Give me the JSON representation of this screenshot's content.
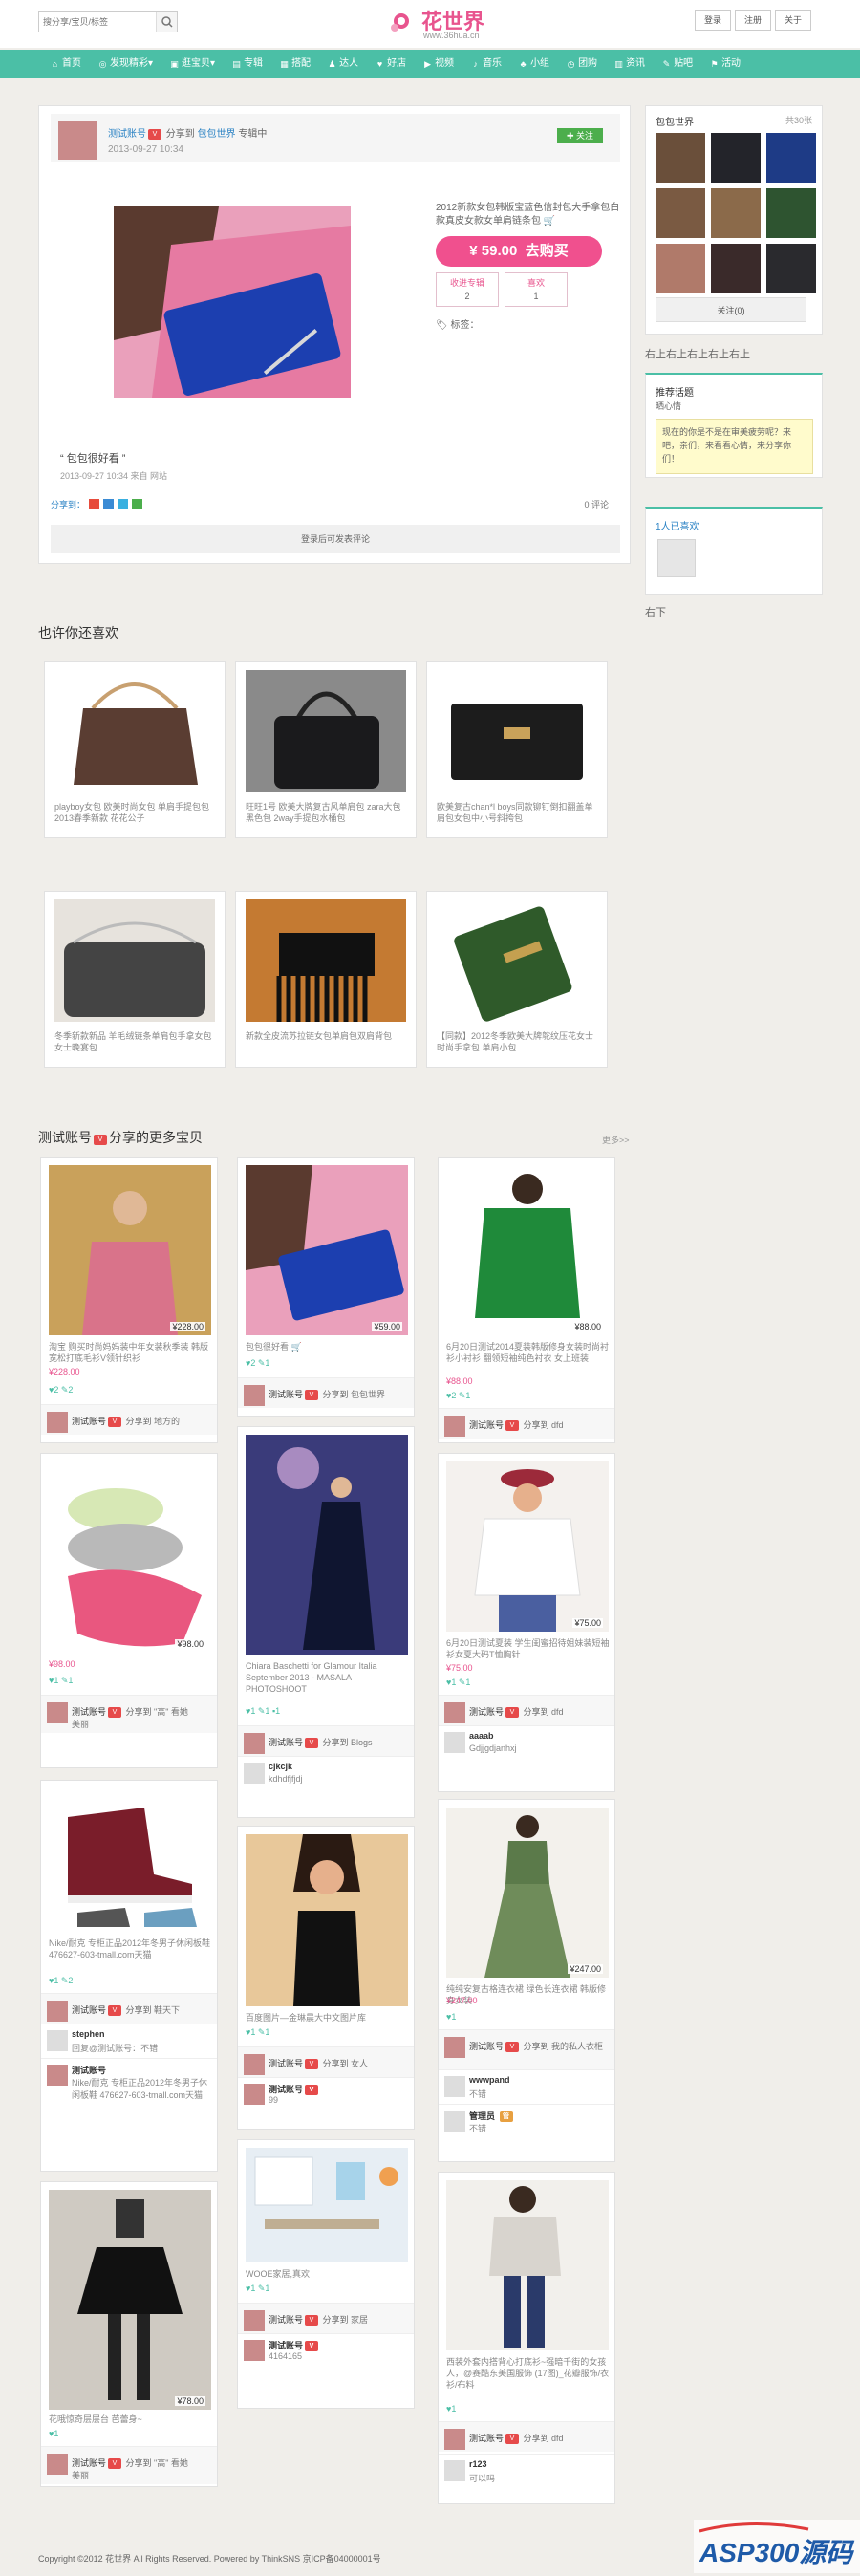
{
  "header": {
    "search_placeholder": "搜分享/宝贝/标签",
    "logo_text": "花世界",
    "logo_url": "www.36hua.cn",
    "links": [
      "登录",
      "注册",
      "关于"
    ]
  },
  "nav": [
    "首页",
    "发现精彩",
    "逛宝贝",
    "专辑",
    "搭配",
    "达人",
    "好店",
    "视频",
    "音乐",
    "小组",
    "团购",
    "资讯",
    "贴吧",
    "活动"
  ],
  "post": {
    "user": "测试账号",
    "verb": "分享到",
    "album": "包包世界",
    "album_suffix": "专辑中",
    "date": "2013-09-27 10:34",
    "follow": "关注",
    "desc": "2012新款女包韩版宝蓝色信封包大手拿包白款真皮女款女单肩链条包",
    "price": "¥ 59.00",
    "buy": "去购买",
    "collect_label": "收进专辑",
    "collect_count": "2",
    "like_label": "喜欢",
    "like_count": "1",
    "tags_label": "标签：",
    "quote": "包包很好看",
    "meta": "2013-09-27 10:34  来自 网站",
    "share_label": "分享到：",
    "comments": "0 评论",
    "login_comment": "登录后可发表评论"
  },
  "sidebar": {
    "title": "包包世界",
    "count": "共30张",
    "follow": "关注(0)",
    "placeholder_text": "右上右上右上右上右上",
    "topic_title": "推荐话题",
    "topic_user": "晒心情",
    "topic_note": "现在的你是不是在审美疲劳呢？来吧，亲们，来看看心情，来分享你们！",
    "likers_title": "1人已喜欢",
    "bottom_text": "右下"
  },
  "related": {
    "title": "也许你还喜欢",
    "items": [
      "playboy女包 欧美时尚女包 单肩手提包包 2013春季新款 花花公子",
      "旺旺1号 欧美大牌复古风单肩包 zara大包黑色包 2way手提包水桶包",
      "欧美复古chan*l boys同款铆钉倒扣翻盖单肩包女包中小号斜挎包",
      "冬季新款新品 羊毛绒链条单肩包手拿女包 女士晚宴包",
      "新款全皮流苏拉链女包单肩包双肩背包",
      "【同款】2012冬季欧美大牌鸵纹压花女士时尚手拿包 单肩小包"
    ]
  },
  "more_section": {
    "title": "测试账号",
    "title_suffix": "分享的更多宝贝",
    "more": "更多>>"
  },
  "waterfall": {
    "c1": [
      {
        "price": "¥228.00",
        "desc": "淘宝 购买时尚妈妈装中年女装秋季装 韩版宽松打底毛衫V领针织衫",
        "line2": "¥228.00",
        "likes": "2",
        "comments": "2",
        "user": "测试账号",
        "album": "地方的"
      },
      {
        "price": "¥98.00",
        "desc": "¥98.00",
        "line2": "",
        "likes": "1",
        "comments": "1",
        "user": "测试账号",
        "album": "\"高\" 看她",
        "album2": "美丽"
      },
      {
        "price": "",
        "desc": "Nike/耐克 专柜正品2012年冬男子休闲板鞋 476627-603-tmall.com天猫",
        "line2": "",
        "likes": "1",
        "comments": "2",
        "user": "测试账号",
        "album": "鞋天下",
        "c_name": "stephen",
        "c_text": "回复@测试账号：不错",
        "c2_name": "测试账号",
        "c2_text": "Nike/耐克 专柜正品2012年冬男子休闲板鞋 476627-603-tmall.com天猫"
      },
      {
        "price": "¥78.00",
        "desc": "花哦惊奇层层台 芭蕾身~",
        "line2": "",
        "likes": "1",
        "comments": "",
        "user": "测试账号",
        "album": "\"高\" 看她",
        "album2": "美丽"
      }
    ],
    "c2": [
      {
        "price": "¥59.00",
        "desc": "包包很好看",
        "line2": "",
        "likes": "2",
        "comments": "1",
        "user": "测试账号",
        "album": "包包世界"
      },
      {
        "price": "",
        "desc": "Chiara Baschetti for Glamour Italia September 2013 - MASALA PHOTOSHOOT",
        "line2": "",
        "likes": "1",
        "comments": "1",
        "extra": "1",
        "user": "测试账号",
        "album": "Blogs",
        "c_name": "cjkcjk",
        "c_text": "kdhdfjfjdj"
      },
      {
        "price": "",
        "desc": "百度图片—金琳晨大中文图片库",
        "line2": "",
        "likes": "1",
        "comments": "1",
        "user": "测试账号",
        "album": "女人",
        "c_name": "测试账号",
        "c_text": "99"
      },
      {
        "price": "",
        "desc": "WOOE家居,真欢",
        "line2": "",
        "likes": "1",
        "comments": "1",
        "user": "测试账号",
        "album": "家居",
        "c_name": "测试账号",
        "c_text": "4164165"
      }
    ],
    "c3": [
      {
        "price": "¥88.00",
        "desc": "6月20日测试2014夏装韩版修身女装时尚衬衫小衬衫 翻领短袖纯色衬衣 女上班装",
        "line2": "¥88.00",
        "likes": "2",
        "comments": "1",
        "user": "测试账号",
        "album": "dfd"
      },
      {
        "price": "¥75.00",
        "desc": "6月20日测试夏装 学生闺蜜招待姐妹装短袖衫女夏大码T恤胸针",
        "line2": "¥75.00",
        "likes": "1",
        "comments": "1",
        "user": "测试账号",
        "album": "dfd",
        "c_name": "aaaab",
        "c_text": "Gdjjgdjanhxj"
      },
      {
        "price": "¥247.00",
        "desc": "纯纯安复古格连衣裙 绿色长连衣裙 韩版修身女装",
        "line2": "¥247.00",
        "likes": "1",
        "comments": "",
        "user": "测试账号",
        "album": "我的私人衣柜",
        "c_name": "wwwpand",
        "c_text": "不错",
        "c2_name": "管理员",
        "c2_text": "不错"
      },
      {
        "price": "",
        "desc": "西装外套内搭背心打底衫~强暗千街的女孩人，@赛酷东美国服饰 (17图)_花瓣服饰/衣衫/布料",
        "line2": "",
        "likes": "1",
        "comments": "",
        "user": "测试账号",
        "album": "dfd",
        "c_name": "r123",
        "c_text": "可以吗"
      }
    ]
  },
  "footer": {
    "text": "Copyright ©2012 花世界 All Rights Reserved. Powered by ThinkSNS  京ICP备04000001号",
    "watermark": "ASP300源码"
  },
  "colors": {
    "accent": "#4bbfa6",
    "brand": "#e8548e",
    "buy": "#f0508e"
  }
}
